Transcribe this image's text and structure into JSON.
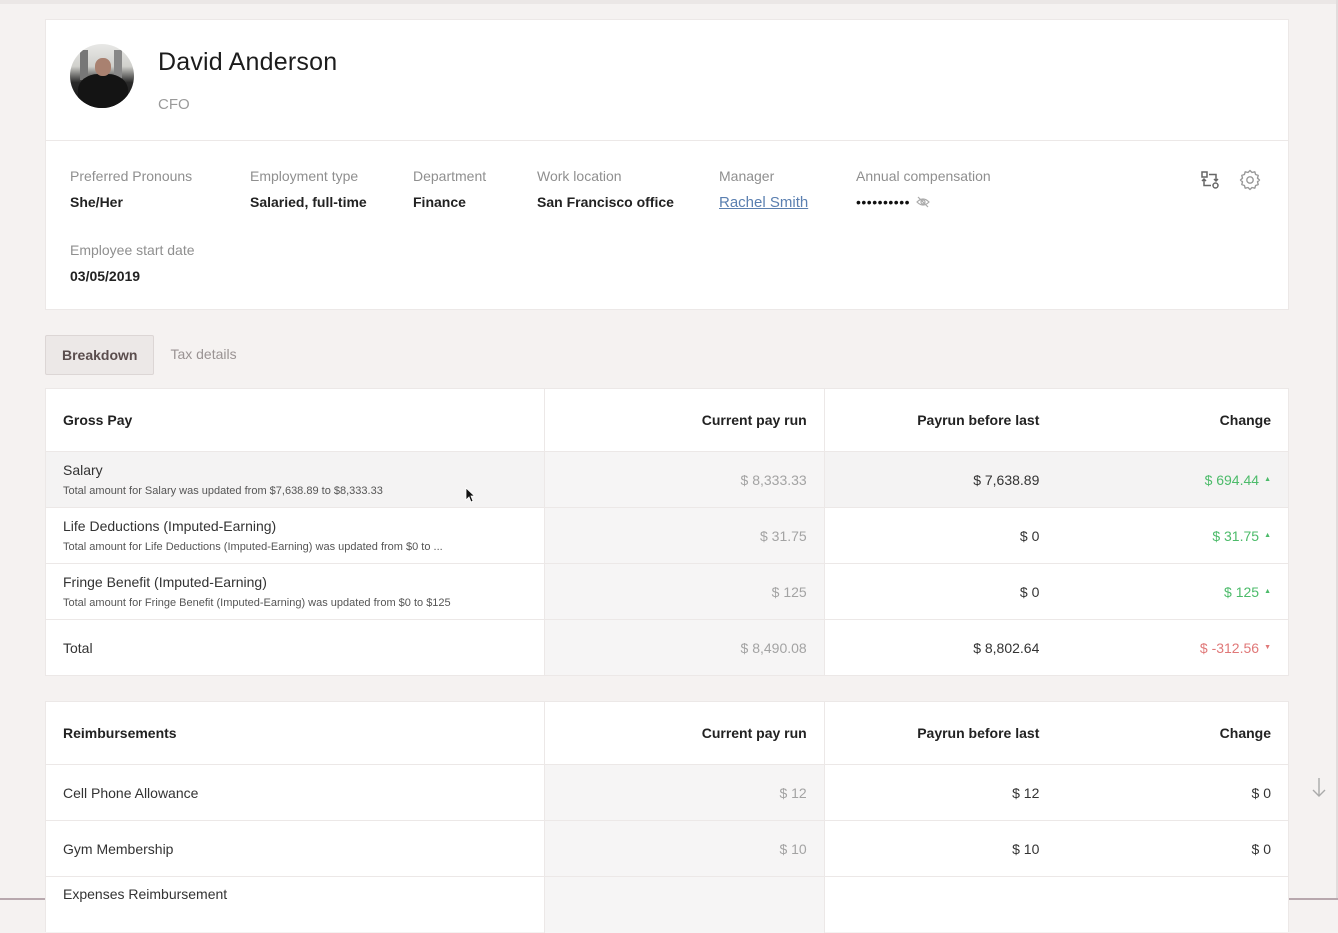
{
  "profile": {
    "name": "David Anderson",
    "title": "CFO",
    "avatar_icon": "user-photo",
    "fields": [
      {
        "label": "Preferred Pronouns",
        "value": "She/Her"
      },
      {
        "label": "Employment type",
        "value": "Salaried, full-time"
      },
      {
        "label": "Department",
        "value": "Finance"
      },
      {
        "label": "Work location",
        "value": "San Francisco office"
      },
      {
        "label": "Manager",
        "value": "Rachel Smith"
      },
      {
        "label": "Annual compensation",
        "value": "••••••••••"
      },
      {
        "label": "Employee start date",
        "value": "03/05/2019"
      }
    ],
    "actions": [
      "compare-icon",
      "gear-icon"
    ]
  },
  "tabs": [
    {
      "label": "Breakdown",
      "active": true
    },
    {
      "label": "Tax details",
      "active": false
    }
  ],
  "gross_pay": {
    "headers": [
      "Gross Pay",
      "Current pay run",
      "Payrun before last",
      "Change"
    ],
    "rows": [
      {
        "name": "Salary",
        "note": "Total amount for Salary was updated from $7,638.89 to $8,333.33",
        "current": "$ 8,333.33",
        "before": "$ 7,638.89",
        "change": "$ 694.44",
        "direction": "up"
      },
      {
        "name": "Life Deductions (Imputed-Earning)",
        "note": "Total amount for Life Deductions (Imputed-Earning) was updated from $0 to ...",
        "current": "$ 31.75",
        "before": "$ 0",
        "change": "$ 31.75",
        "direction": "up"
      },
      {
        "name": "Fringe Benefit (Imputed-Earning)",
        "note": "Total amount for Fringe Benefit (Imputed-Earning) was updated from $0 to $125",
        "current": "$ 125",
        "before": "$ 0",
        "change": "$ 125",
        "direction": "up"
      },
      {
        "name": "Total",
        "note": "",
        "current": "$ 8,490.08",
        "before": "$ 8,802.64",
        "change": "$ -312.56",
        "direction": "down"
      }
    ],
    "arrows": {
      "up": "▲",
      "down": "▼"
    }
  },
  "reimbursements": {
    "headers": [
      "Reimbursements",
      "Current pay run",
      "Payrun before last",
      "Change"
    ],
    "rows": [
      {
        "name": "Cell Phone Allowance",
        "current": "$ 12",
        "before": "$ 12",
        "change": "$ 0"
      },
      {
        "name": "Gym Membership",
        "current": "$ 10",
        "before": "$ 10",
        "change": "$ 0"
      },
      {
        "name": "Expenses Reimbursement",
        "current": "",
        "before": "",
        "change": ""
      }
    ]
  },
  "colors": {
    "positive": "#4cbb6a",
    "negative": "#e07878",
    "link": "#5a7fb0"
  }
}
